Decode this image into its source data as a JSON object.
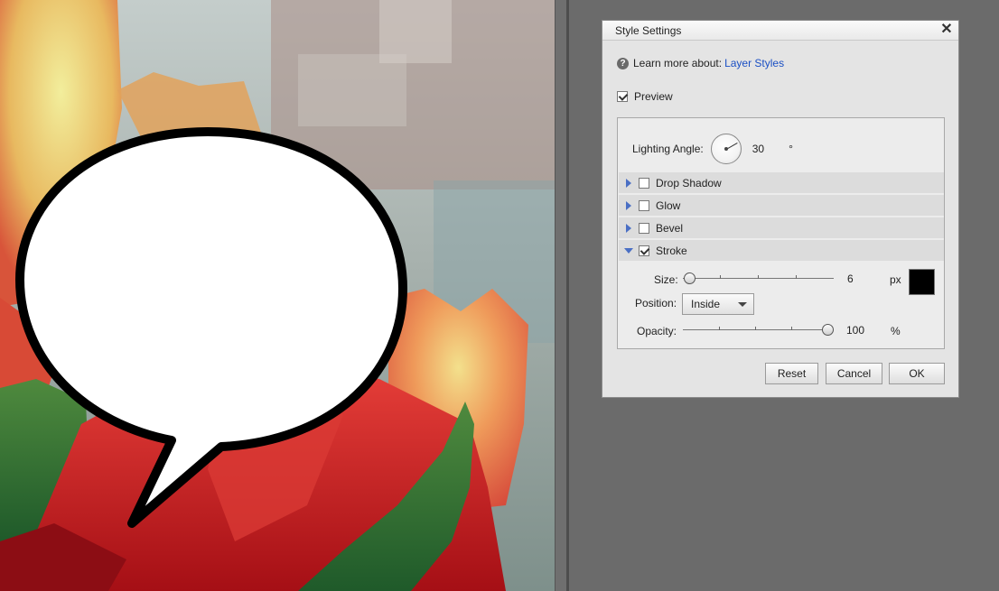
{
  "dialog": {
    "title": "Style Settings",
    "close_glyph": "✕",
    "help": {
      "icon": "?",
      "text": "Learn more about:",
      "link": "Layer Styles"
    },
    "preview": {
      "label": "Preview",
      "checked": true
    },
    "lighting": {
      "label": "Lighting Angle:",
      "value": "30",
      "unit": "°"
    },
    "sections": [
      {
        "label": "Drop Shadow",
        "expanded": false,
        "checked": false
      },
      {
        "label": "Glow",
        "expanded": false,
        "checked": false
      },
      {
        "label": "Bevel",
        "expanded": false,
        "checked": false
      },
      {
        "label": "Stroke",
        "expanded": true,
        "checked": true
      }
    ],
    "stroke": {
      "size_label": "Size:",
      "size_value": "6",
      "size_unit": "px",
      "size_fraction": 0.04,
      "color": "#000000",
      "position_label": "Position:",
      "position_value": "Inside",
      "opacity_label": "Opacity:",
      "opacity_value": "100",
      "opacity_unit": "%",
      "opacity_fraction": 1.0
    },
    "buttons": {
      "reset": "Reset",
      "cancel": "Cancel",
      "ok": "OK"
    }
  },
  "colors": {
    "accent_link": "#1a4fc4",
    "expander": "#4a6fc4",
    "stroke_color": "#000000"
  }
}
